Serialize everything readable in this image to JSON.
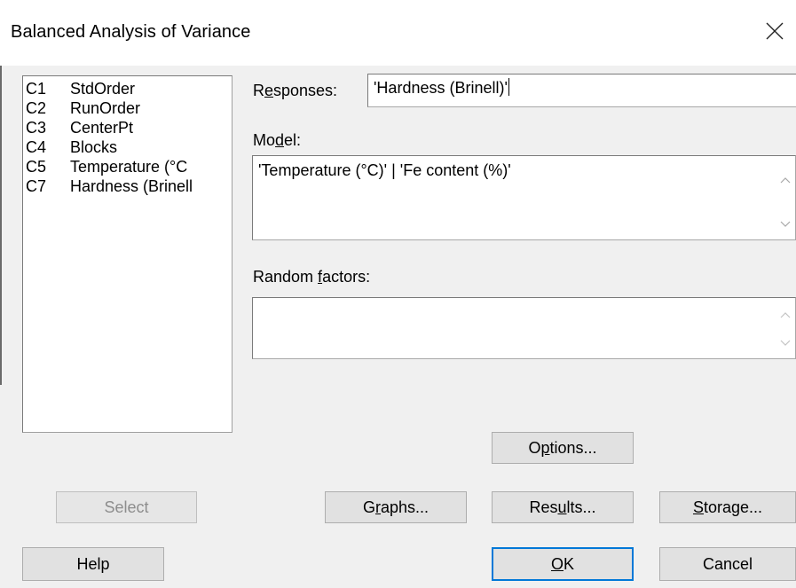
{
  "window": {
    "title": "Balanced Analysis of Variance"
  },
  "icons": {
    "close": "close-icon",
    "scroll_up": "chevron-up-icon",
    "scroll_down": "chevron-down-icon"
  },
  "columns": [
    {
      "col": "C1",
      "name": "StdOrder"
    },
    {
      "col": "C2",
      "name": "RunOrder"
    },
    {
      "col": "C3",
      "name": "CenterPt"
    },
    {
      "col": "C4",
      "name": "Blocks"
    },
    {
      "col": "C5",
      "name": "Temperature (°C"
    },
    {
      "col": "C7",
      "name": "Hardness (Brinell"
    }
  ],
  "responses": {
    "label_pre": "R",
    "label_u": "e",
    "label_post": "sponses:",
    "value": "'Hardness (Brinell)'"
  },
  "model": {
    "label_pre": "Mo",
    "label_u": "d",
    "label_post": "el:",
    "value": "'Temperature (°C)' | 'Fe content (%)'"
  },
  "random_factors": {
    "label_pre": "Random ",
    "label_u": "f",
    "label_post": "actors:",
    "value": ""
  },
  "buttons": {
    "select": {
      "label": "Select"
    },
    "options": {
      "pre": "O",
      "u": "p",
      "post": "tions..."
    },
    "graphs": {
      "pre": "G",
      "u": "r",
      "post": "aphs..."
    },
    "results": {
      "pre": "Res",
      "u": "u",
      "post": "lts..."
    },
    "storage": {
      "pre": "",
      "u": "S",
      "post": "torage..."
    },
    "help": {
      "label": "Help"
    },
    "ok": {
      "pre": "",
      "u": "O",
      "post": "K"
    },
    "cancel": {
      "label": "Cancel"
    }
  },
  "colors": {
    "default_button_border": "#0078d7",
    "disabled_text": "#8d8d8d",
    "dialog_bg": "#f0f0f0"
  }
}
